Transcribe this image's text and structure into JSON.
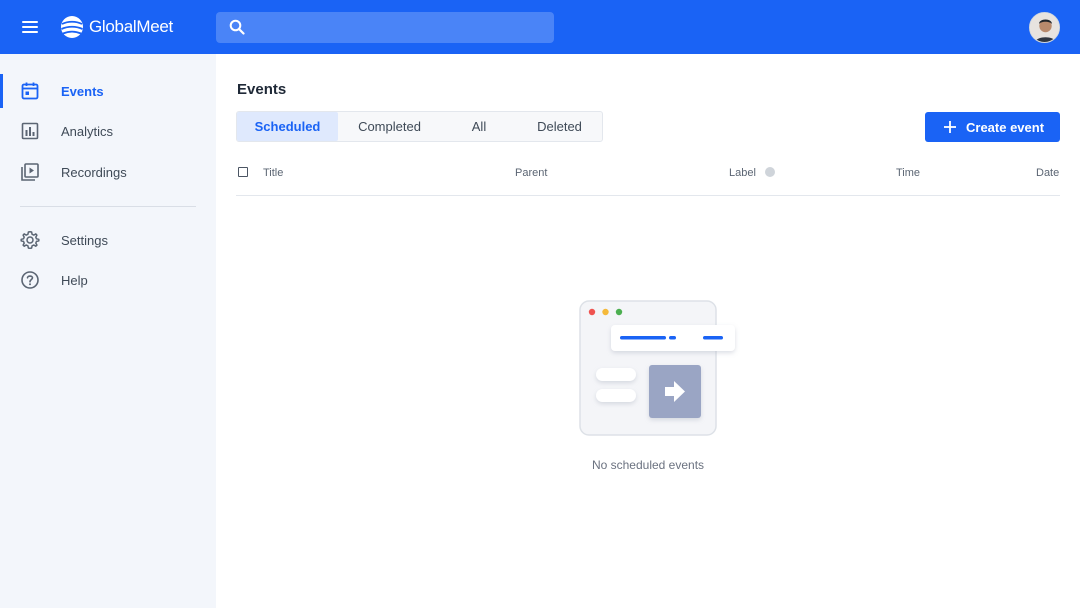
{
  "app": {
    "name": "GlobalMeet",
    "brand_color": "#1a63f5"
  },
  "header": {
    "menu_icon": "hamburger-menu-icon",
    "search": {
      "placeholder": "",
      "value": "",
      "icon": "search-icon"
    },
    "avatar_icon": "user-avatar"
  },
  "sidebar": {
    "items": [
      {
        "label": "Events",
        "icon": "calendar-icon",
        "active": true
      },
      {
        "label": "Analytics",
        "icon": "bar-chart-icon",
        "active": false
      },
      {
        "label": "Recordings",
        "icon": "video-library-icon",
        "active": false
      }
    ],
    "secondary": [
      {
        "label": "Settings",
        "icon": "gear-icon"
      },
      {
        "label": "Help",
        "icon": "help-circle-icon"
      }
    ]
  },
  "main": {
    "title": "Events",
    "tabs": [
      {
        "label": "Scheduled",
        "active": true
      },
      {
        "label": "Completed",
        "active": false
      },
      {
        "label": "All",
        "active": false
      },
      {
        "label": "Deleted",
        "active": false
      }
    ],
    "create_button": "Create event",
    "table": {
      "columns": [
        "Title",
        "Parent",
        "Label",
        "Time",
        "Date"
      ]
    },
    "empty_state": "No scheduled events"
  }
}
